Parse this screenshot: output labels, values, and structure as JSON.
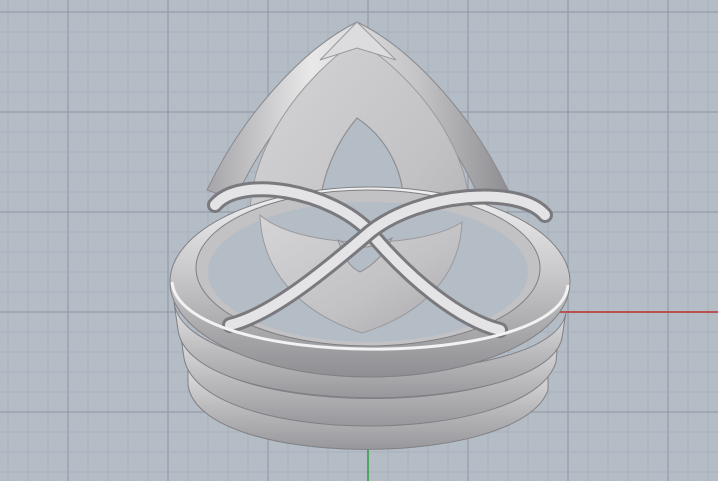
{
  "viewport": {
    "view_type": "perspective",
    "background_color": "#b4bcc6",
    "grid_minor_color": "#a6aeb9",
    "grid_major_color": "#939ca8",
    "axes": {
      "x_color": "#c0302a",
      "y_color": "#2fa03a",
      "z_color": "#3a45c8"
    },
    "model": {
      "object": "ring",
      "material_color": "#c7c7c9",
      "highlight_color": "#eeeeee",
      "shadow_color": "#8d8d90"
    }
  }
}
